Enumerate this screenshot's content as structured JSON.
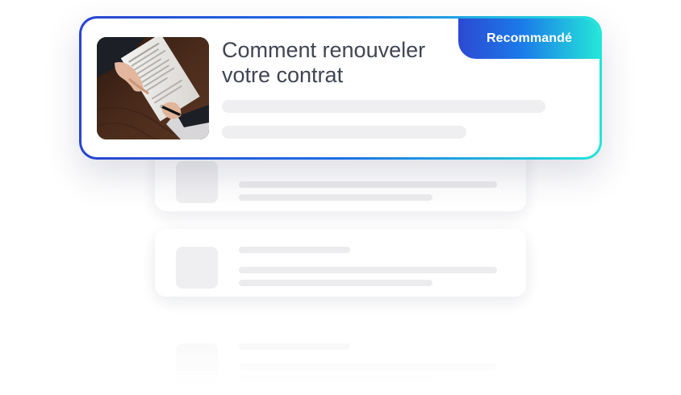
{
  "featured": {
    "badge": "Recommandé",
    "title": "Comment renouveler votre contrat",
    "image_icon": "contract-signing-photo"
  },
  "colors": {
    "gradient_start": "#2a45cf",
    "gradient_mid": "#1e6fe8",
    "gradient_end": "#23e5d9",
    "title_text": "#404553",
    "placeholder": "#efeff1"
  }
}
